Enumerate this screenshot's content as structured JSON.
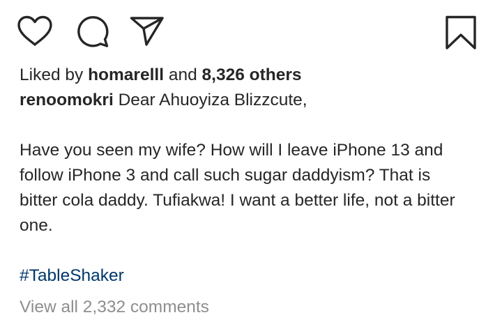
{
  "actions": {
    "like_icon": "heart-outline",
    "comment_icon": "speech-bubble",
    "share_icon": "paper-plane",
    "save_icon": "bookmark-outline"
  },
  "likes": {
    "prefix": "Liked by",
    "user": "homarelll",
    "conjunction": "and",
    "others": "8,326 others"
  },
  "caption": {
    "username": "renoomokri",
    "first_line": "Dear Ahuoyiza Blizzcute,",
    "body": "Have you seen my wife? How will I leave iPhone 13 and follow iPhone 3 and call such sugar daddyism? That is bitter cola daddy. Tufiakwa! I want a better life, not a bitter one.",
    "hashtag": "#TableShaker"
  },
  "comments": {
    "view_all_label": "View all 2,332 comments"
  },
  "colors": {
    "text": "#262626",
    "link": "#00376b",
    "muted": "#8e8e8e"
  }
}
